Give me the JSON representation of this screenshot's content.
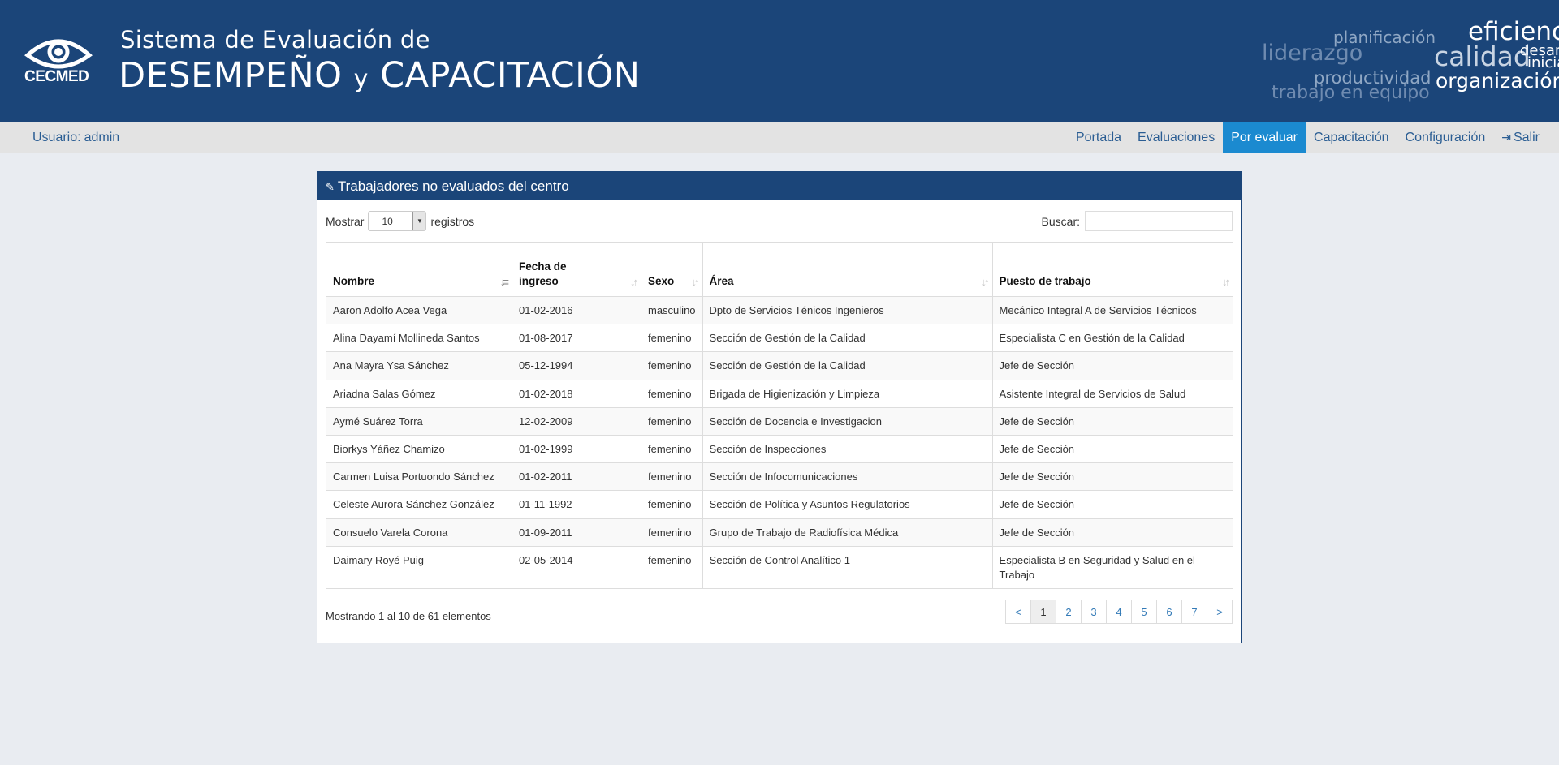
{
  "header": {
    "logo_text": "CECMED",
    "title_line1": "Sistema de Evaluación de",
    "title_line2_a": "DESEMPEÑO",
    "title_line2_b": "y",
    "title_line2_c": "CAPACITACIÓN",
    "word_cloud": {
      "planificacion": "planificación",
      "eficiencia": "eficiencia",
      "liderazgo": "liderazgo",
      "calidad": "calidad",
      "desarrollo": "desarrollo",
      "iniciativa": "iniciativa",
      "productividad": "productividad",
      "organizacion": "organización",
      "trabajo": "trabajo en equipo"
    }
  },
  "navbar": {
    "user_label": "Usuario:",
    "user_name": "admin",
    "items": [
      {
        "label": "Portada"
      },
      {
        "label": "Evaluaciones"
      },
      {
        "label": "Por evaluar"
      },
      {
        "label": "Capacitación"
      },
      {
        "label": "Configuración"
      },
      {
        "label": "Salir"
      }
    ],
    "active": "Por evaluar"
  },
  "panel": {
    "title": "Trabajadores no evaluados del centro",
    "show_label": "Mostrar",
    "page_size": "10",
    "records_label": "registros",
    "search_label": "Buscar:",
    "search_value": ""
  },
  "table": {
    "headers": {
      "nombre": "Nombre",
      "fecha_a": "Fecha de",
      "fecha_b": "ingreso",
      "sexo": "Sexo",
      "area": "Área",
      "puesto": "Puesto de trabajo"
    },
    "rows": [
      {
        "nombre": "Aaron Adolfo Acea Vega",
        "fecha": "01-02-2016",
        "sexo": "masculino",
        "area": "Dpto de Servicios Ténicos Ingenieros",
        "puesto": "Mecánico Integral A de Servicios Técnicos"
      },
      {
        "nombre": "Alina Dayamí Mollineda Santos",
        "fecha": "01-08-2017",
        "sexo": "femenino",
        "area": "Sección de Gestión de la Calidad",
        "puesto": "Especialista C en Gestión de la Calidad"
      },
      {
        "nombre": "Ana Mayra Ysa Sánchez",
        "fecha": "05-12-1994",
        "sexo": "femenino",
        "area": "Sección de Gestión de la Calidad",
        "puesto": "Jefe de Sección"
      },
      {
        "nombre": "Ariadna Salas Gómez",
        "fecha": "01-02-2018",
        "sexo": "femenino",
        "area": "Brigada de Higienización y Limpieza",
        "puesto": "Asistente Integral de Servicios de Salud"
      },
      {
        "nombre": "Aymé Suárez Torra",
        "fecha": "12-02-2009",
        "sexo": "femenino",
        "area": "Sección de Docencia e Investigacion",
        "puesto": "Jefe de Sección"
      },
      {
        "nombre": "Biorkys Yáñez Chamizo",
        "fecha": "01-02-1999",
        "sexo": "femenino",
        "area": "Sección de Inspecciones",
        "puesto": "Jefe de Sección"
      },
      {
        "nombre": "Carmen Luisa Portuondo Sánchez",
        "fecha": "01-02-2011",
        "sexo": "femenino",
        "area": "Sección de Infocomunicaciones",
        "puesto": "Jefe de Sección"
      },
      {
        "nombre": "Celeste Aurora Sánchez González",
        "fecha": "01-11-1992",
        "sexo": "femenino",
        "area": "Sección de Política y Asuntos Regulatorios",
        "puesto": "Jefe de Sección"
      },
      {
        "nombre": "Consuelo Varela Corona",
        "fecha": "01-09-2011",
        "sexo": "femenino",
        "area": "Grupo de Trabajo de Radiofísica Médica",
        "puesto": "Jefe de Sección"
      },
      {
        "nombre": "Daimary Royé Puig",
        "fecha": "02-05-2014",
        "sexo": "femenino",
        "area": "Sección de Control Analítico 1",
        "puesto": "Especialista B en Seguridad y Salud en el Trabajo"
      }
    ]
  },
  "footer": {
    "info": "Mostrando 1 al 10 de 61 elementos",
    "pager": [
      "<",
      "1",
      "2",
      "3",
      "4",
      "5",
      "6",
      "7",
      ">"
    ],
    "current_page": "1"
  },
  "colors": {
    "header_bg": "#1b4579",
    "active_nav": "#1b8ad0",
    "link": "#2a5d93"
  }
}
